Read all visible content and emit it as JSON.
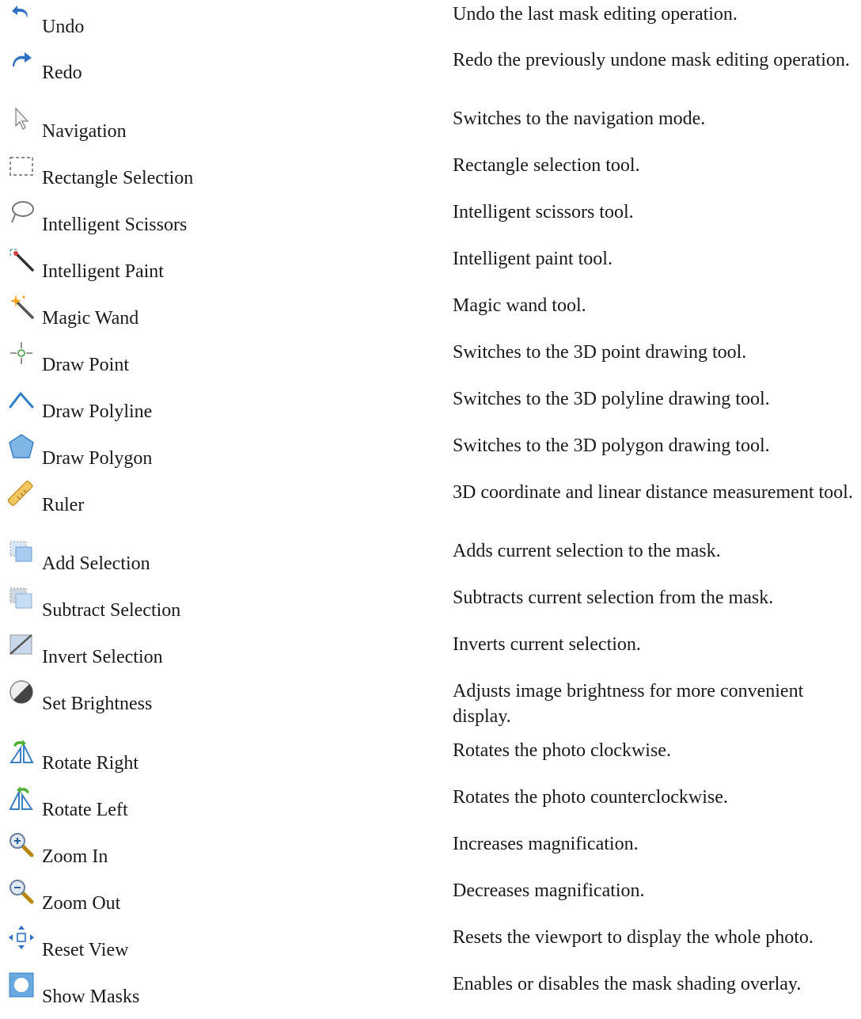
{
  "tools": [
    {
      "icon": "undo-icon",
      "name": "Undo",
      "description": "Undo the last mask editing operation."
    },
    {
      "icon": "redo-icon",
      "name": "Redo",
      "description": "Redo the previously undone mask editing operation."
    },
    {
      "icon": "navigation-icon",
      "name": "Navigation",
      "description": "Switches to the navigation mode."
    },
    {
      "icon": "rectangle-selection-icon",
      "name": "Rectangle Selection",
      "description": "Rectangle selection tool."
    },
    {
      "icon": "intelligent-scissors-icon",
      "name": "Intelligent Scissors",
      "description": "Intelligent scissors tool."
    },
    {
      "icon": "intelligent-paint-icon",
      "name": "Intelligent Paint",
      "description": "Intelligent paint tool."
    },
    {
      "icon": "magic-wand-icon",
      "name": "Magic Wand",
      "description": "Magic wand tool."
    },
    {
      "icon": "draw-point-icon",
      "name": "Draw Point",
      "description": "Switches to the 3D point drawing tool."
    },
    {
      "icon": "draw-polyline-icon",
      "name": "Draw Polyline",
      "description": "Switches to the 3D polyline drawing tool."
    },
    {
      "icon": "draw-polygon-icon",
      "name": "Draw Polygon",
      "description": "Switches to the 3D polygon drawing tool."
    },
    {
      "icon": "ruler-icon",
      "name": "Ruler",
      "description": "3D coordinate and linear distance measurement tool."
    },
    {
      "icon": "add-selection-icon",
      "name": "Add Selection",
      "description": "Adds current selection to the mask."
    },
    {
      "icon": "subtract-selection-icon",
      "name": "Subtract Selection",
      "description": "Subtracts current selection from the mask."
    },
    {
      "icon": "invert-selection-icon",
      "name": "Invert Selection",
      "description": "Inverts current selection."
    },
    {
      "icon": "set-brightness-icon",
      "name": "Set Brightness",
      "description": "Adjusts image brightness for more convenient display."
    },
    {
      "icon": "rotate-right-icon",
      "name": "Rotate Right",
      "description": "Rotates the photo clockwise."
    },
    {
      "icon": "rotate-left-icon",
      "name": "Rotate Left",
      "description": "Rotates the photo counterclockwise."
    },
    {
      "icon": "zoom-in-icon",
      "name": "Zoom In",
      "description": "Increases magnification."
    },
    {
      "icon": "zoom-out-icon",
      "name": "Zoom Out",
      "description": "Decreases magnification."
    },
    {
      "icon": "reset-view-icon",
      "name": "Reset View",
      "description": "Resets the viewport to display the whole photo."
    },
    {
      "icon": "show-masks-icon",
      "name": "Show Masks",
      "description": "Enables or disables the mask shading overlay."
    }
  ]
}
